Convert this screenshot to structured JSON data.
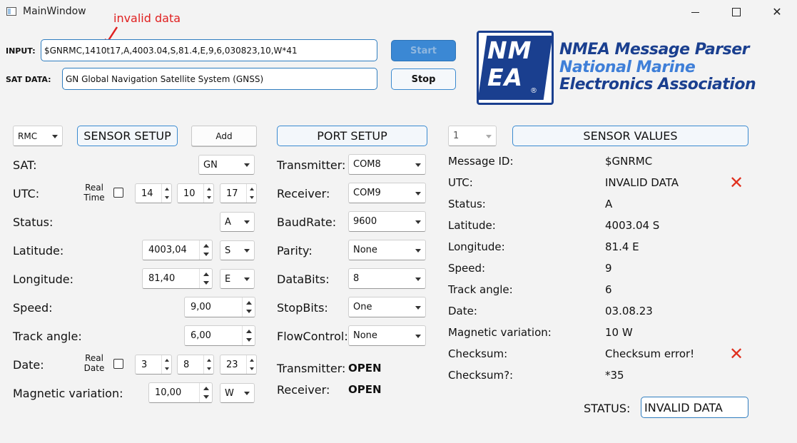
{
  "window": {
    "title": "MainWindow",
    "minimize": "—",
    "maximize": "☐",
    "close": "✕"
  },
  "annotation": {
    "text": "invalid data",
    "color": "#e02020"
  },
  "input": {
    "label": "INPUT:",
    "value": "$GNRMC,1410t17,A,4003.04,S,81.4,E,9,6,030823,10,W*41"
  },
  "sat_data": {
    "label": "SAT DATA:",
    "value": "GN Global Navigation Satellite System (GNSS)"
  },
  "buttons": {
    "start": "Start",
    "stop": "Stop"
  },
  "logo": {
    "letters": "NMEA",
    "registered": "®",
    "line1": "NMEA Message Parser",
    "line2": "National Marine",
    "line3": "Electronics Association",
    "color_dark": "#1a3f8f",
    "color_light": "#3f7fd8"
  },
  "sensor_setup": {
    "type_combo": "RMC",
    "header": "SENSOR SETUP",
    "add": "Add",
    "sat": {
      "label": "SAT:",
      "value": "GN"
    },
    "utc": {
      "label": "UTC:",
      "realtime": "Real Time",
      "h": "14",
      "m": "10",
      "s": "17"
    },
    "status": {
      "label": "Status:",
      "value": "A"
    },
    "latitude": {
      "label": "Latitude:",
      "value": "4003,04",
      "dir": "S"
    },
    "longitude": {
      "label": "Longitude:",
      "value": "81,40",
      "dir": "E"
    },
    "speed": {
      "label": "Speed:",
      "value": "9,00"
    },
    "track": {
      "label": "Track angle:",
      "value": "6,00"
    },
    "date": {
      "label": "Date:",
      "realdate": "Real Date",
      "d": "3",
      "m": "8",
      "y": "23"
    },
    "magvar": {
      "label": "Magnetic variation:",
      "value": "10,00",
      "dir": "W"
    }
  },
  "port_setup": {
    "header": "PORT SETUP",
    "rows": [
      {
        "label": "Transmitter:",
        "value": "COM8"
      },
      {
        "label": "Receiver:",
        "value": "COM9"
      },
      {
        "label": "BaudRate:",
        "value": "9600"
      },
      {
        "label": "Parity:",
        "value": "None"
      },
      {
        "label": "DataBits:",
        "value": "8"
      },
      {
        "label": "StopBits:",
        "value": "One"
      },
      {
        "label": "FlowControl:",
        "value": "None"
      }
    ],
    "transmitter_status": {
      "label": "Transmitter:",
      "value": "OPEN"
    },
    "receiver_status": {
      "label": "Receiver:",
      "value": "OPEN"
    }
  },
  "sensor_values": {
    "index": "1",
    "header": "SENSOR VALUES",
    "rows": [
      {
        "label": "Message ID:",
        "value": "$GNRMC"
      },
      {
        "label": "UTC:",
        "value": "INVALID DATA"
      },
      {
        "label": "Status:",
        "value": "A"
      },
      {
        "label": "Latitude:",
        "value": "4003.04 S"
      },
      {
        "label": "Longitude:",
        "value": "81.4 E"
      },
      {
        "label": "Speed:",
        "value": "9"
      },
      {
        "label": "Track angle:",
        "value": "6"
      },
      {
        "label": "Date:",
        "value": "03.08.23"
      },
      {
        "label": "Magnetic variation:",
        "value": "10 W"
      },
      {
        "label": "Checksum:",
        "value": "Checksum error!"
      },
      {
        "label": "Checksum?:",
        "value": "*35"
      }
    ],
    "error_mark": "✕",
    "status_label": "STATUS:",
    "status_value": "INVALID DATA"
  }
}
